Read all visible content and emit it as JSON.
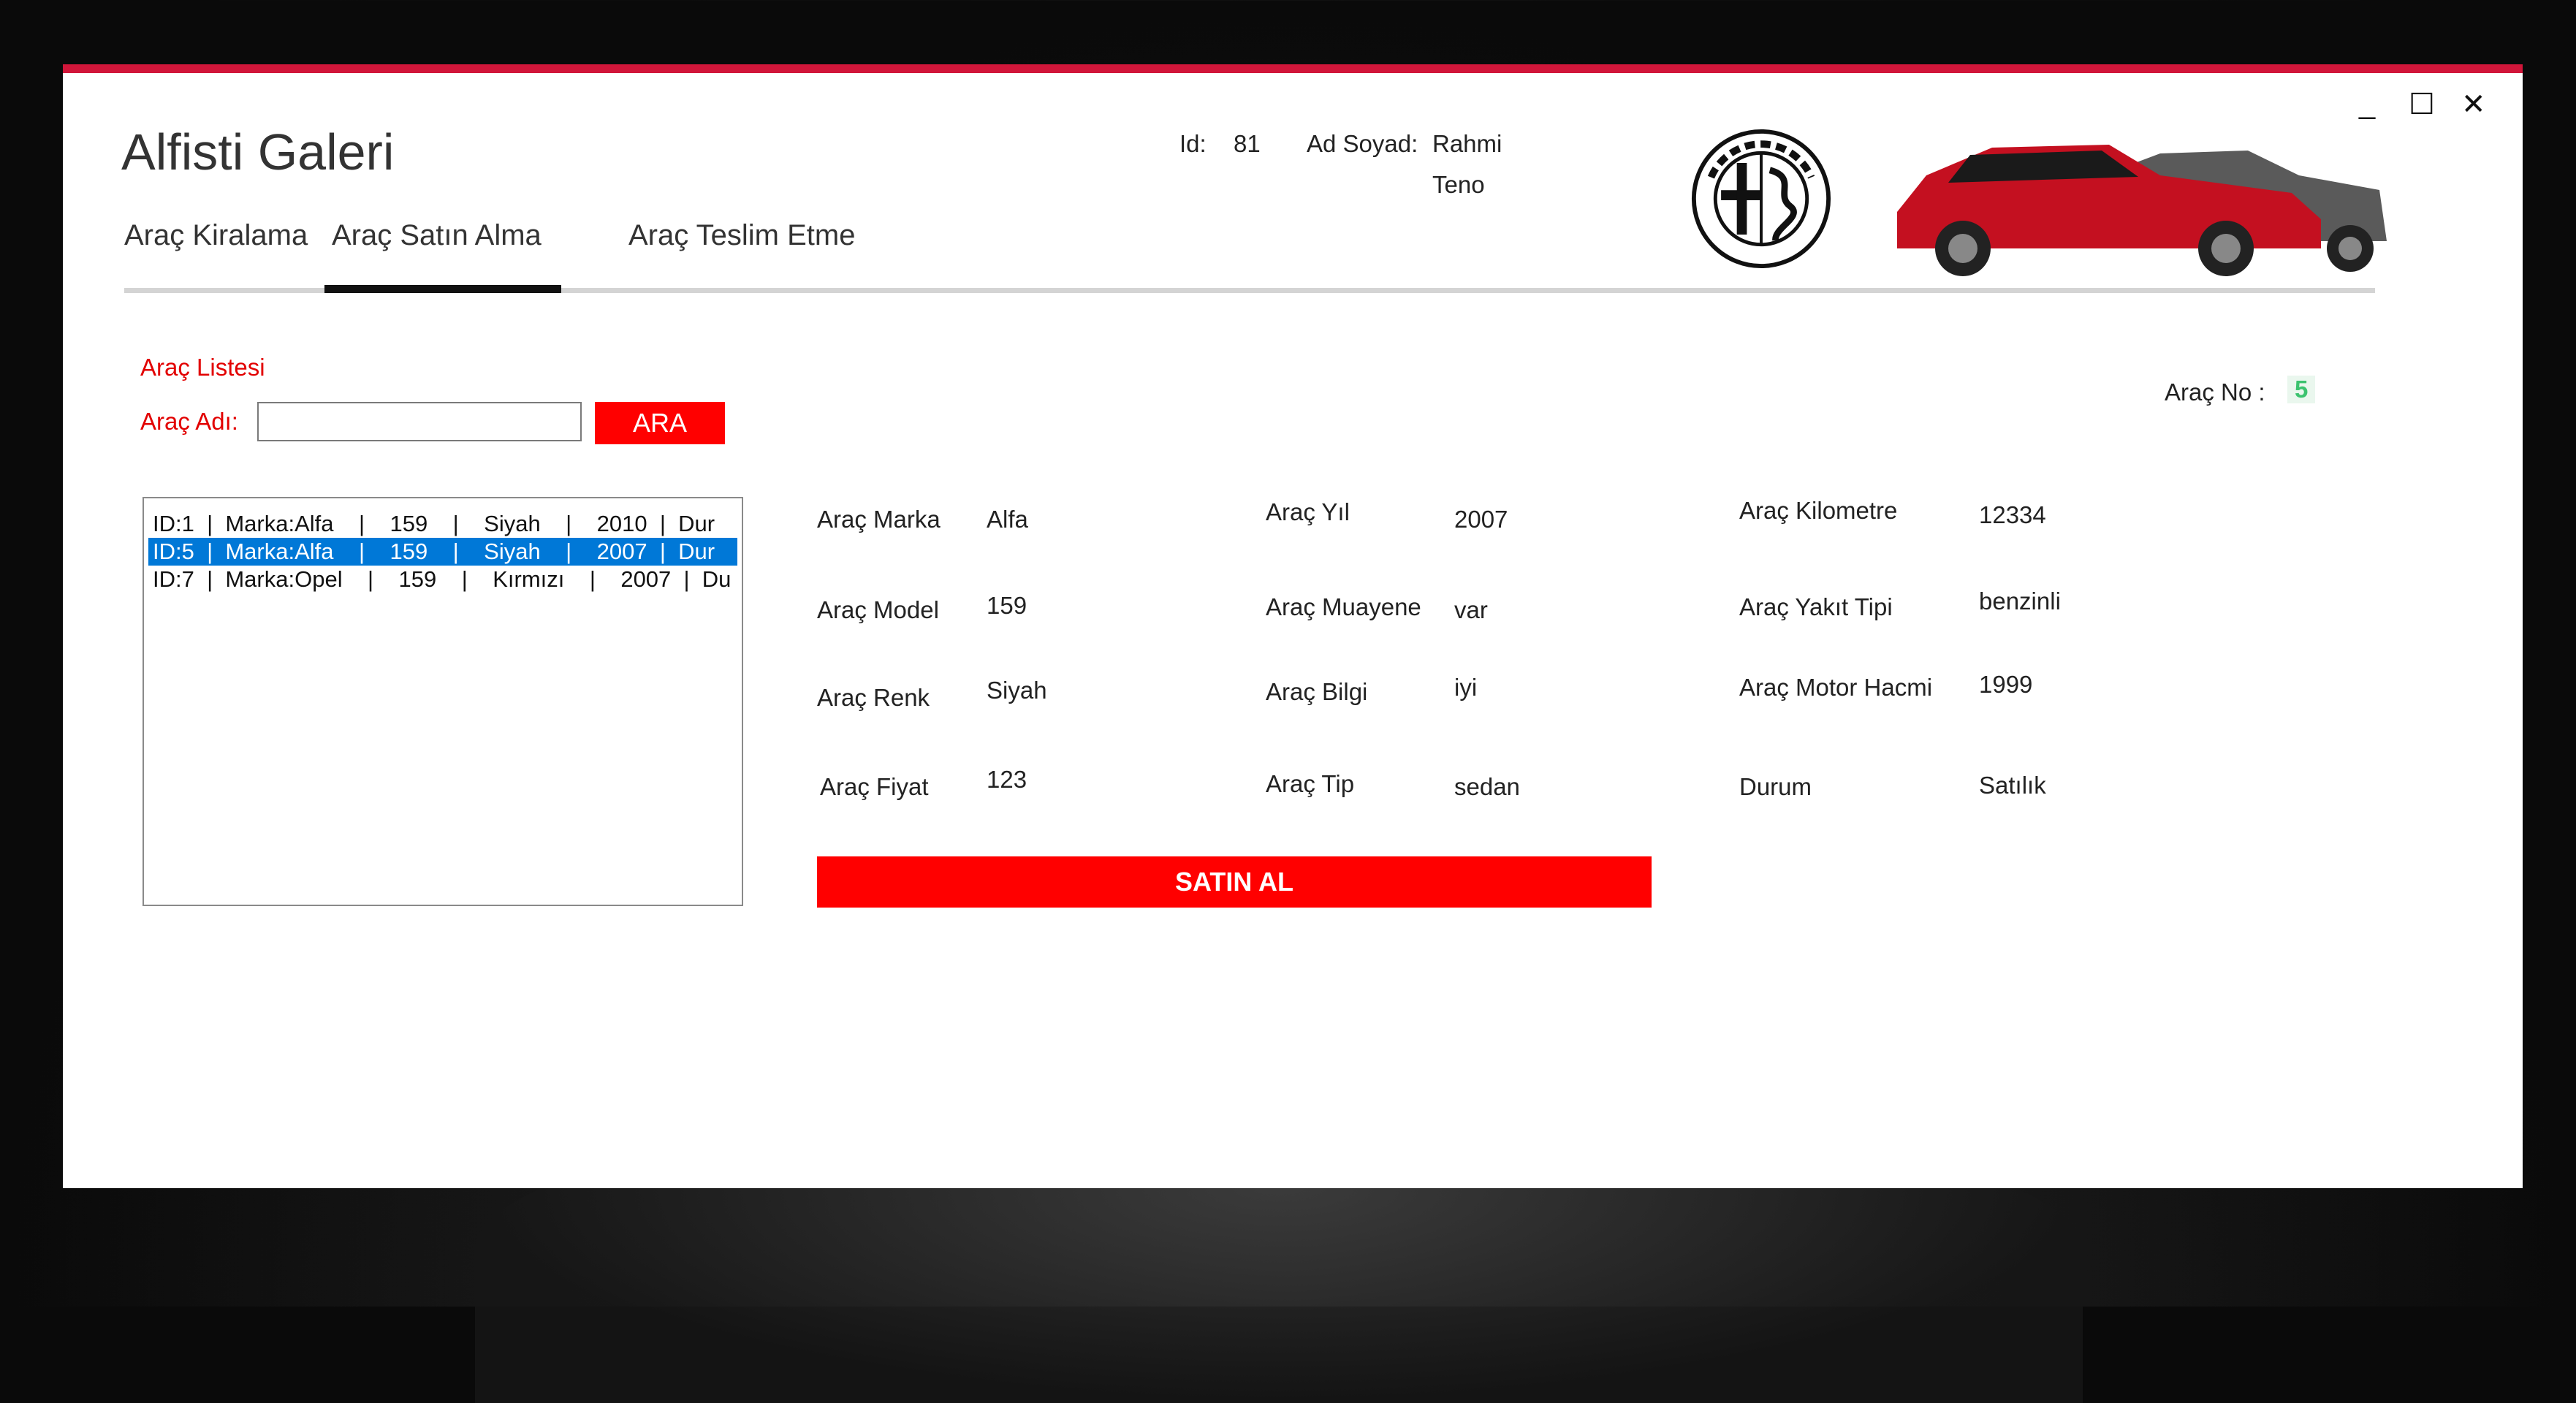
{
  "window": {
    "app_title": "Alfisti Galeri",
    "controls": {
      "minimize": "_",
      "maximize": "☐",
      "close": "✕"
    }
  },
  "user": {
    "id_label": "Id:",
    "id_value": "81",
    "name_label": "Ad Soyad:",
    "first_name": "Rahmi",
    "last_name": "Teno"
  },
  "tabs": [
    {
      "label": "Araç Kiralama",
      "active": false
    },
    {
      "label": "Araç Satın Alma",
      "active": true
    },
    {
      "label": "Araç Teslim Etme",
      "active": false
    }
  ],
  "search": {
    "list_title": "Araç Listesi",
    "name_label": "Araç Adı:",
    "input_value": "",
    "button_label": "ARA"
  },
  "vehicle_no": {
    "label": "Araç No :",
    "value": "5"
  },
  "vehicle_list": [
    {
      "text": "ID:1  |  Marka:Alfa    |    159    |    Siyah    |    2010  |  Dur",
      "selected": false
    },
    {
      "text": "ID:5  |  Marka:Alfa    |    159    |    Siyah    |    2007  |  Dur",
      "selected": true
    },
    {
      "text": "ID:7  |  Marka:Opel    |    159    |    Kırmızı    |    2007  |  Du",
      "selected": false
    }
  ],
  "details": {
    "marka_label": "Araç Marka",
    "marka_value": "Alfa",
    "model_label": "Araç Model",
    "model_value": "159",
    "renk_label": "Araç Renk",
    "renk_value": "Siyah",
    "fiyat_label": "Araç Fiyat",
    "fiyat_value": "123",
    "yil_label": "Araç Yıl",
    "yil_value": "2007",
    "muayene_label": "Araç Muayene",
    "muayene_value": "var",
    "bilgi_label": "Araç Bilgi",
    "bilgi_value": "iyi",
    "tip_label": "Araç Tip",
    "tip_value": "sedan",
    "kilometre_label": "Araç Kilometre",
    "kilometre_value": "12334",
    "yakit_label": "Araç Yakıt Tipi",
    "yakit_value": "benzinli",
    "motor_label": "Araç Motor Hacmi",
    "motor_value": "1999",
    "durum_label": "Durum",
    "durum_value": "Satılık"
  },
  "buy_button": "SATIN AL",
  "colors": {
    "accent": "#d1163a",
    "button_red": "#ff0000",
    "green": "#3cc36f",
    "selection": "#0078d7"
  }
}
